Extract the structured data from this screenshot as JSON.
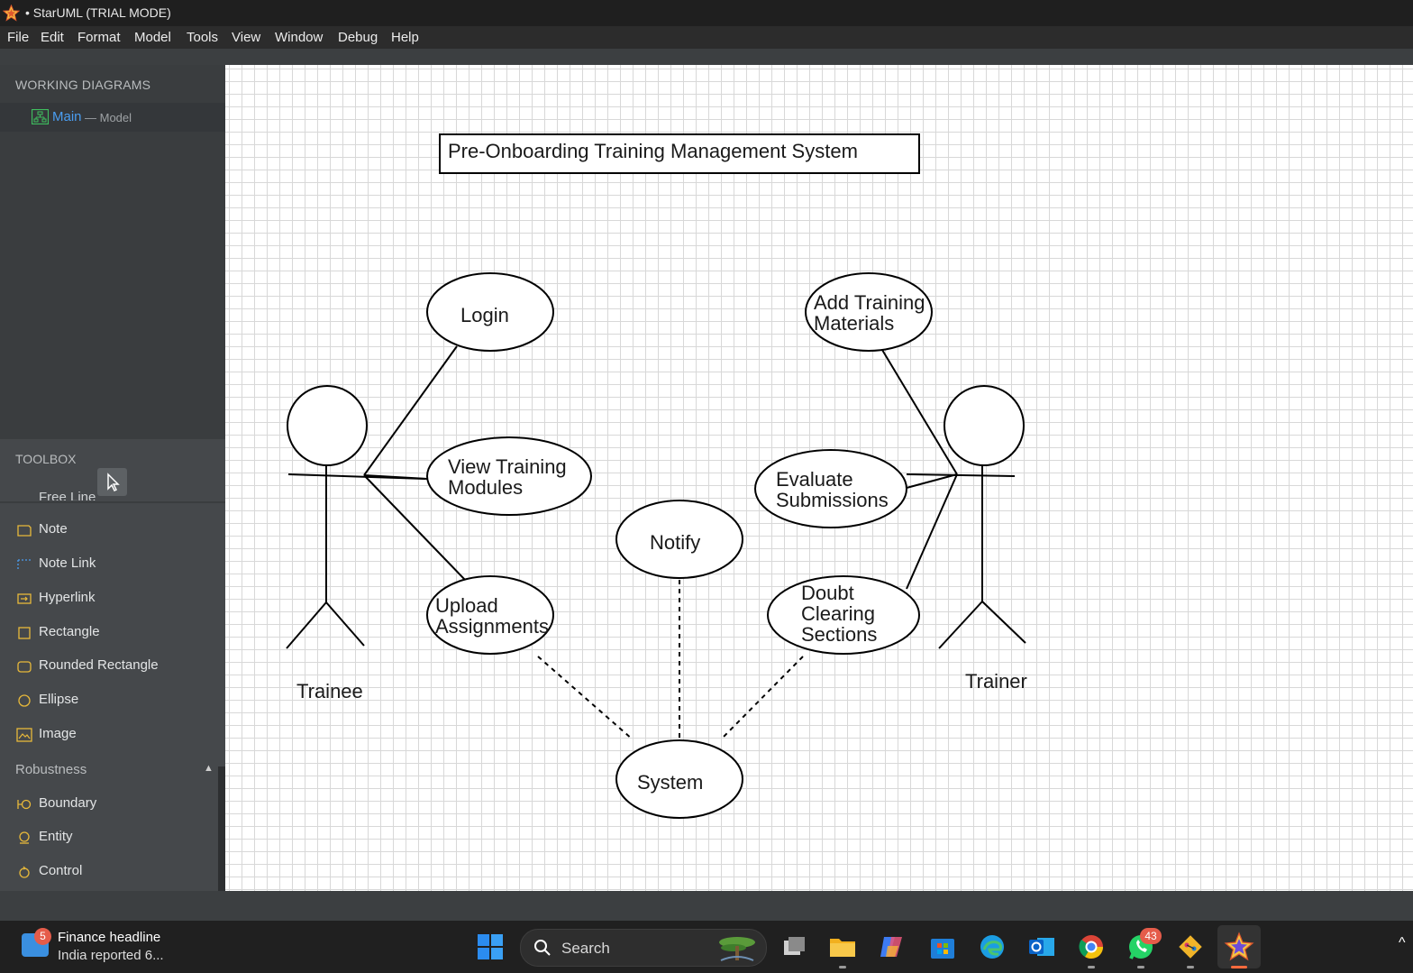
{
  "window": {
    "title": "• StarUML (TRIAL MODE)"
  },
  "menu": [
    "File",
    "Edit",
    "Format",
    "Model",
    "Tools",
    "View",
    "Window",
    "Debug",
    "Help"
  ],
  "working_diagrams": {
    "title": "WORKING DIAGRAMS",
    "item": {
      "name": "Main",
      "suffix": "— Model",
      "icon": "diagram-icon"
    }
  },
  "toolbox": {
    "title": "TOOLBOX",
    "partial_item": "Free Line",
    "annotation_items": [
      {
        "label": "Note",
        "icon": "note-icon"
      },
      {
        "label": "Note Link",
        "icon": "note-link-icon"
      },
      {
        "label": "Hyperlink",
        "icon": "hyperlink-icon"
      },
      {
        "label": "Rectangle",
        "icon": "rectangle-icon"
      },
      {
        "label": "Rounded Rectangle",
        "icon": "rounded-rectangle-icon"
      },
      {
        "label": "Ellipse",
        "icon": "ellipse-icon"
      },
      {
        "label": "Image",
        "icon": "image-icon"
      }
    ],
    "group": "Robustness",
    "robustness_items": [
      {
        "label": "Boundary",
        "icon": "boundary-icon"
      },
      {
        "label": "Entity",
        "icon": "entity-icon"
      },
      {
        "label": "Control",
        "icon": "control-icon"
      }
    ]
  },
  "diagram": {
    "title": "Pre-Onboarding Training Management System",
    "actors": [
      "Trainee",
      "Trainer"
    ],
    "use_cases": {
      "login": "Login",
      "view_training": [
        "View Training",
        "Modules"
      ],
      "upload": [
        "Upload",
        "Assignments"
      ],
      "notify": "Notify",
      "add_materials": [
        "Add Training",
        "Materials"
      ],
      "evaluate": [
        "Evaluate",
        "Submissions"
      ],
      "doubt": [
        "Doubt",
        "Clearing",
        "Sections"
      ],
      "system": "System"
    }
  },
  "taskbar": {
    "news": {
      "badge": "5",
      "title": "Finance headline",
      "subtitle": "India reported 6..."
    },
    "search_label": "Search",
    "whatsapp_badge": "43",
    "apps": [
      "task-view",
      "file-explorer",
      "copilot",
      "microsoft-store",
      "edge",
      "outlook",
      "chrome",
      "whatsapp",
      "git-client",
      "staruml"
    ]
  },
  "colors": {
    "link": "#4a9df0",
    "tool_icon": "#e8b93a",
    "badge": "#e55c4a"
  }
}
